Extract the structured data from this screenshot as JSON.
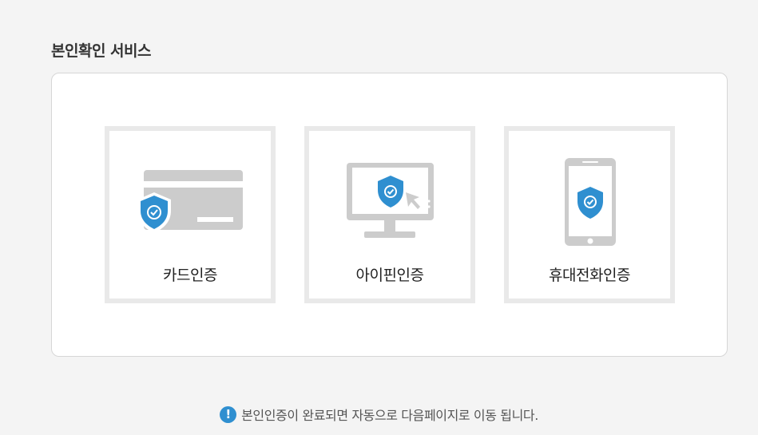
{
  "page": {
    "title": "본인확인 서비스"
  },
  "auth_options": [
    {
      "label": "카드인증",
      "icon": "credit-card-shield-icon"
    },
    {
      "label": "아이핀인증",
      "icon": "monitor-shield-icon"
    },
    {
      "label": "휴대전화인증",
      "icon": "smartphone-shield-icon"
    }
  ],
  "notice": {
    "icon": "exclamation-icon",
    "glyph": "!",
    "text": "본인인증이 완료되면 자동으로 다음페이지로 이동 됩니다."
  },
  "colors": {
    "accent": "#2f8fd0",
    "icon_gray": "#cccccc",
    "border": "#e9e9e9"
  }
}
